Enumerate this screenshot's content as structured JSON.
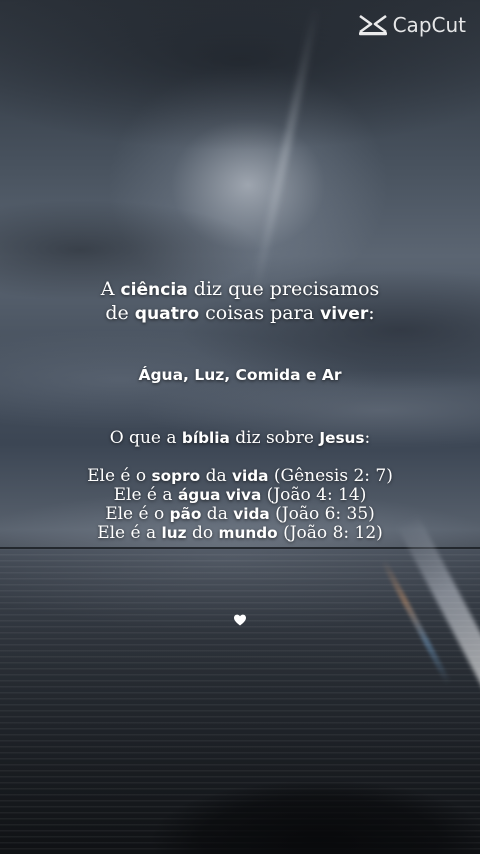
{
  "watermark": {
    "icon": "capcut-logo-icon",
    "label": "CapCut"
  },
  "intro": {
    "line1": {
      "prefix": "A ",
      "bold1": "ciência",
      "rest": " diz que precisamos"
    },
    "line2": {
      "prefix": "de ",
      "bold1": "quatro",
      "middle": " coisas para ",
      "bold2": "viver",
      "suffix": ":"
    }
  },
  "elements_line": "Água, Luz, Comida e Ar",
  "bible": {
    "prefix": "O que a ",
    "bold1": "bíblia",
    "middle": " diz sobre ",
    "bold2": "Jesus",
    "suffix": ":"
  },
  "verses": [
    {
      "a": "Ele é o ",
      "b": "sopro",
      "c": " da ",
      "d": "vida",
      "e": " (Gênesis 2: 7)"
    },
    {
      "a": "Ele é a ",
      "b": "água viva",
      "c": " (João 4: 14)",
      "d": "",
      "e": ""
    },
    {
      "a": "Ele é o ",
      "b": "pão",
      "c": " da ",
      "d": "vida",
      "e": " (João 6: 35)"
    },
    {
      "a": "Ele é a ",
      "b": "luz",
      "c": " do ",
      "d": "mundo",
      "e": " (João 8: 12)"
    }
  ],
  "heart_icon": "heart-icon",
  "colors": {
    "text": "#ffffff",
    "sky": "#46505c",
    "sea": "#1e2228"
  }
}
